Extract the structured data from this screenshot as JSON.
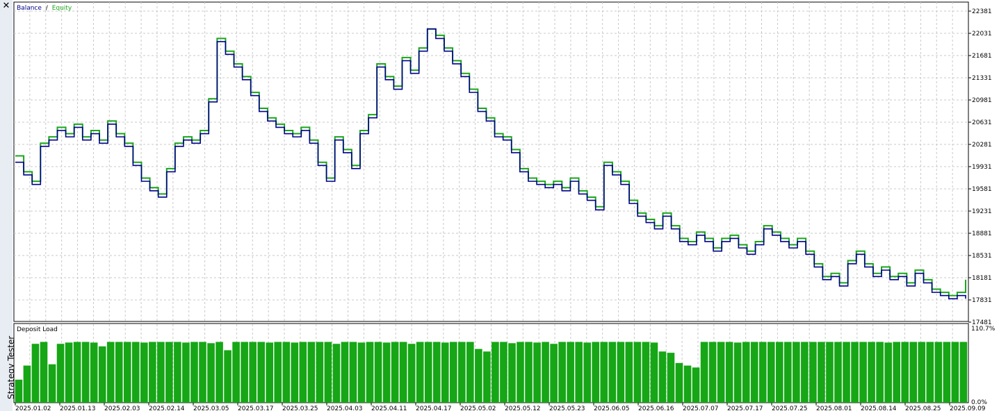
{
  "window": {
    "panel_title": "Strategy Tester",
    "close_icon": "close-icon"
  },
  "colors": {
    "balance": "#00008b",
    "equity": "#1aa61a",
    "load": "#16a616",
    "grid": "#c8c8c8"
  },
  "legend": {
    "balance": "Balance",
    "slash": "/",
    "equity": "Equity"
  },
  "chart_data": [
    {
      "type": "line",
      "title": "",
      "series": [
        {
          "name": "Balance",
          "values": [
            20000,
            19800,
            19650,
            20250,
            20350,
            20500,
            20400,
            20550,
            20350,
            20450,
            20300,
            20600,
            20400,
            20250,
            19950,
            19700,
            19550,
            19450,
            19850,
            20250,
            20350,
            20300,
            20450,
            20950,
            21900,
            21700,
            21500,
            21300,
            21050,
            20800,
            20650,
            20550,
            20450,
            20400,
            20500,
            20300,
            19950,
            19700,
            20350,
            20150,
            19900,
            20450,
            20700,
            21500,
            21300,
            21150,
            21600,
            21400,
            21750,
            22100,
            21950,
            21750,
            21550,
            21350,
            21100,
            20800,
            20650,
            20400,
            20350,
            20150,
            19850,
            19700,
            19650,
            19600,
            19650,
            19550,
            19700,
            19500,
            19400,
            19250,
            19950,
            19800,
            19650,
            19350,
            19150,
            19050,
            18950,
            19150,
            18950,
            18750,
            18700,
            18850,
            18750,
            18600,
            18750,
            18800,
            18650,
            18550,
            18700,
            18950,
            18850,
            18750,
            18650,
            18750,
            18550,
            18350,
            18150,
            18200,
            18050,
            18400,
            18550,
            18350,
            18200,
            18300,
            18150,
            18200,
            18050,
            18250,
            18100,
            17950,
            17900,
            17850,
            17900,
            17850
          ]
        },
        {
          "name": "Equity",
          "values": [
            20100,
            19850,
            19700,
            20300,
            20400,
            20550,
            20450,
            20600,
            20400,
            20500,
            20350,
            20650,
            20450,
            20300,
            20000,
            19750,
            19600,
            19500,
            19900,
            20300,
            20400,
            20350,
            20500,
            21000,
            21950,
            21750,
            21550,
            21350,
            21100,
            20850,
            20700,
            20600,
            20500,
            20450,
            20550,
            20350,
            20000,
            19750,
            20400,
            20200,
            19950,
            20500,
            20750,
            21550,
            21350,
            21200,
            21650,
            21450,
            21800,
            22100,
            22000,
            21800,
            21600,
            21400,
            21150,
            20850,
            20700,
            20450,
            20400,
            20200,
            19900,
            19750,
            19700,
            19650,
            19700,
            19600,
            19750,
            19550,
            19450,
            19300,
            20000,
            19850,
            19700,
            19400,
            19200,
            19100,
            19000,
            19200,
            19000,
            18800,
            18750,
            18900,
            18800,
            18650,
            18800,
            18850,
            18700,
            18600,
            18750,
            19000,
            18900,
            18800,
            18700,
            18800,
            18600,
            18400,
            18200,
            18250,
            18100,
            18450,
            18600,
            18400,
            18250,
            18350,
            18200,
            18250,
            18100,
            18300,
            18150,
            18000,
            17950,
            17900,
            17950,
            18150
          ]
        }
      ],
      "x": [
        "2025.01.02",
        "2025.01.13",
        "2025.02.03",
        "2025.02.14",
        "2025.03.05",
        "2025.03.17",
        "2025.03.25",
        "2025.04.03",
        "2025.04.11",
        "2025.04.17",
        "2025.05.02",
        "2025.05.12",
        "2025.05.23",
        "2025.06.05",
        "2025.06.16",
        "2025.07.07",
        "2025.07.17",
        "2025.07.25",
        "2025.08.01",
        "2025.08.14",
        "2025.08.25",
        "2025.09.09"
      ],
      "y_ticks": [
        "22381",
        "22031",
        "21681",
        "21331",
        "20981",
        "20631",
        "20281",
        "19931",
        "19581",
        "19231",
        "18881",
        "18531",
        "18181",
        "17831",
        "17481"
      ],
      "ylim": [
        17481,
        22381
      ],
      "grid": true,
      "legend": "top-left"
    },
    {
      "type": "bar",
      "title": "Deposit Load",
      "y_ticks": [
        "110.7%",
        "0.0%"
      ],
      "ylim": [
        0,
        110.7
      ],
      "values": [
        36,
        58,
        92,
        95,
        60,
        92,
        94,
        95,
        95,
        94,
        88,
        95,
        95,
        95,
        95,
        94,
        95,
        95,
        95,
        95,
        94,
        95,
        95,
        93,
        95,
        82,
        95,
        95,
        95,
        95,
        94,
        95,
        95,
        94,
        95,
        95,
        95,
        95,
        92,
        95,
        95,
        94,
        95,
        95,
        94,
        95,
        95,
        92,
        95,
        95,
        95,
        94,
        95,
        95,
        95,
        84,
        80,
        95,
        95,
        93,
        95,
        95,
        94,
        95,
        92,
        95,
        95,
        95,
        94,
        95,
        95,
        95,
        95,
        95,
        95,
        95,
        94,
        80,
        78,
        62,
        58,
        55,
        95,
        95,
        95,
        95,
        94,
        95,
        95,
        95,
        95,
        95,
        95,
        95,
        95,
        95,
        95,
        95,
        95,
        95,
        95,
        95,
        95,
        95,
        94,
        95,
        95,
        95,
        95,
        95,
        95,
        95,
        95,
        95
      ]
    }
  ]
}
